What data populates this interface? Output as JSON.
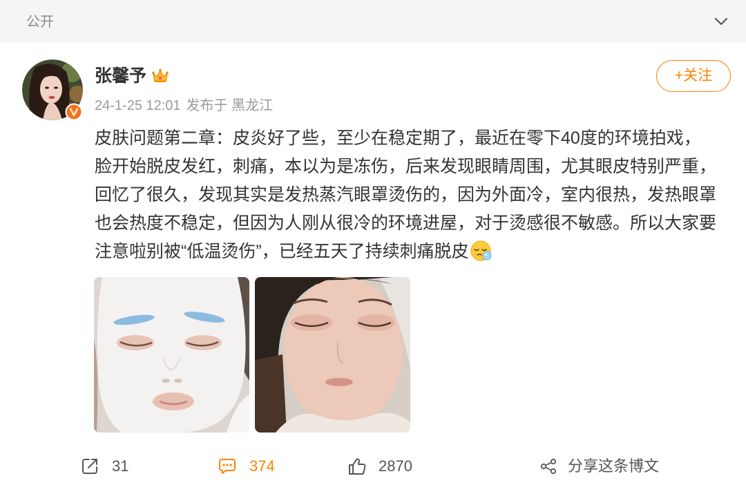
{
  "header": {
    "visibility_label": "公开",
    "collapse_icon": "chevron-down-icon"
  },
  "post": {
    "author": {
      "name": "张馨予",
      "verified_badge_icon": "verified-badge-icon",
      "member_badge_icon": "crown-icon"
    },
    "meta": {
      "time": "24-1-25 12:01",
      "location": "发布于 黑龙江"
    },
    "follow_label": "+关注",
    "text_lines": [
      "皮肤问题第二章：皮炎好了些，至少在稳定期了，最近在零下40度的环境拍戏，",
      "脸开始脱皮发红，刺痛，本以为是冻伤，后来发现眼睛周围，尤其眼皮特别严重，",
      "回忆了很久，发现其实是发热蒸汽眼罩烫伤的，因为外面冷，室内很热，发热眼罩",
      "也会热度不稳定，但因为人刚从很冷的环境进屋，对于烫感很不敏感。所以大家要",
      "注意啦别被“低温烫伤”，已经五天了持续刺痛脱皮"
    ],
    "trailing_emoji_icon": "sleepy-emoji-icon"
  },
  "actions": {
    "repost": {
      "icon": "repost-icon",
      "count": "31"
    },
    "comment": {
      "icon": "comment-icon",
      "count": "374"
    },
    "like": {
      "icon": "like-icon",
      "count": "2870"
    },
    "share": {
      "icon": "share-icon",
      "label": "分享这条博文"
    }
  },
  "colors": {
    "accent": "#ff8200",
    "text": "#333333",
    "muted": "#999999",
    "action_text": "#555555",
    "header_bg": "#f5f5f5"
  }
}
